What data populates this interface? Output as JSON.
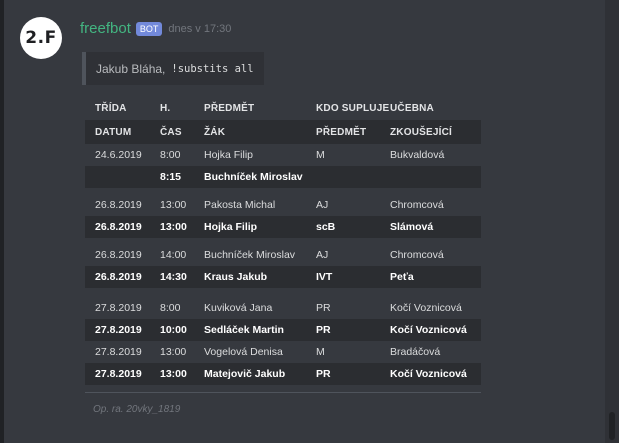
{
  "avatar_text": "2.F",
  "message": {
    "username": "freefbot",
    "badge": "BOT",
    "timestamp": "dnes v 17:30",
    "quote_user": "Jakub Bláha,",
    "quote_command": "!substits all"
  },
  "table": {
    "header1": [
      "TŘÍDA",
      "H.",
      "PŘEDMĚT",
      "KDO SUPLUJE",
      "UČEBNA"
    ],
    "header2": [
      "DATUM",
      "ČAS",
      "ŽÁK",
      "PŘEDMĚT",
      "ZKOUŠEJÍCÍ"
    ],
    "rows": [
      [
        "24.6.2019",
        "8:00",
        "Hojka Filip",
        "M",
        "Bukvaldová"
      ],
      [
        "",
        "8:15",
        "Buchníček Miroslav",
        "",
        ""
      ],
      [
        "26.8.2019",
        "13:00",
        "Pakosta Michal",
        "AJ",
        "Chromcová"
      ],
      [
        "26.8.2019",
        "13:00",
        "Hojka Filip",
        "scB",
        "Slámová"
      ],
      [
        "26.8.2019",
        "14:00",
        "Buchníček Miroslav",
        "AJ",
        "Chromcová"
      ],
      [
        "26.8.2019",
        "14:30",
        "Kraus Jakub",
        "IVT",
        "Peťa"
      ],
      [
        "27.8.2019",
        "8:00",
        "Kuviková Jana",
        "PR",
        "Kočí Voznicová"
      ],
      [
        "27.8.2019",
        "10:00",
        "Sedláček Martin",
        "PR",
        "Kočí Voznicová"
      ],
      [
        "27.8.2019",
        "13:00",
        "Vogelová Denisa",
        "M",
        "Bradáčová"
      ],
      [
        "27.8.2019",
        "13:00",
        "Matejovič Jakub",
        "PR",
        "Kočí Voznicová"
      ]
    ]
  },
  "footer": "Op. ra. 20vky_1819"
}
